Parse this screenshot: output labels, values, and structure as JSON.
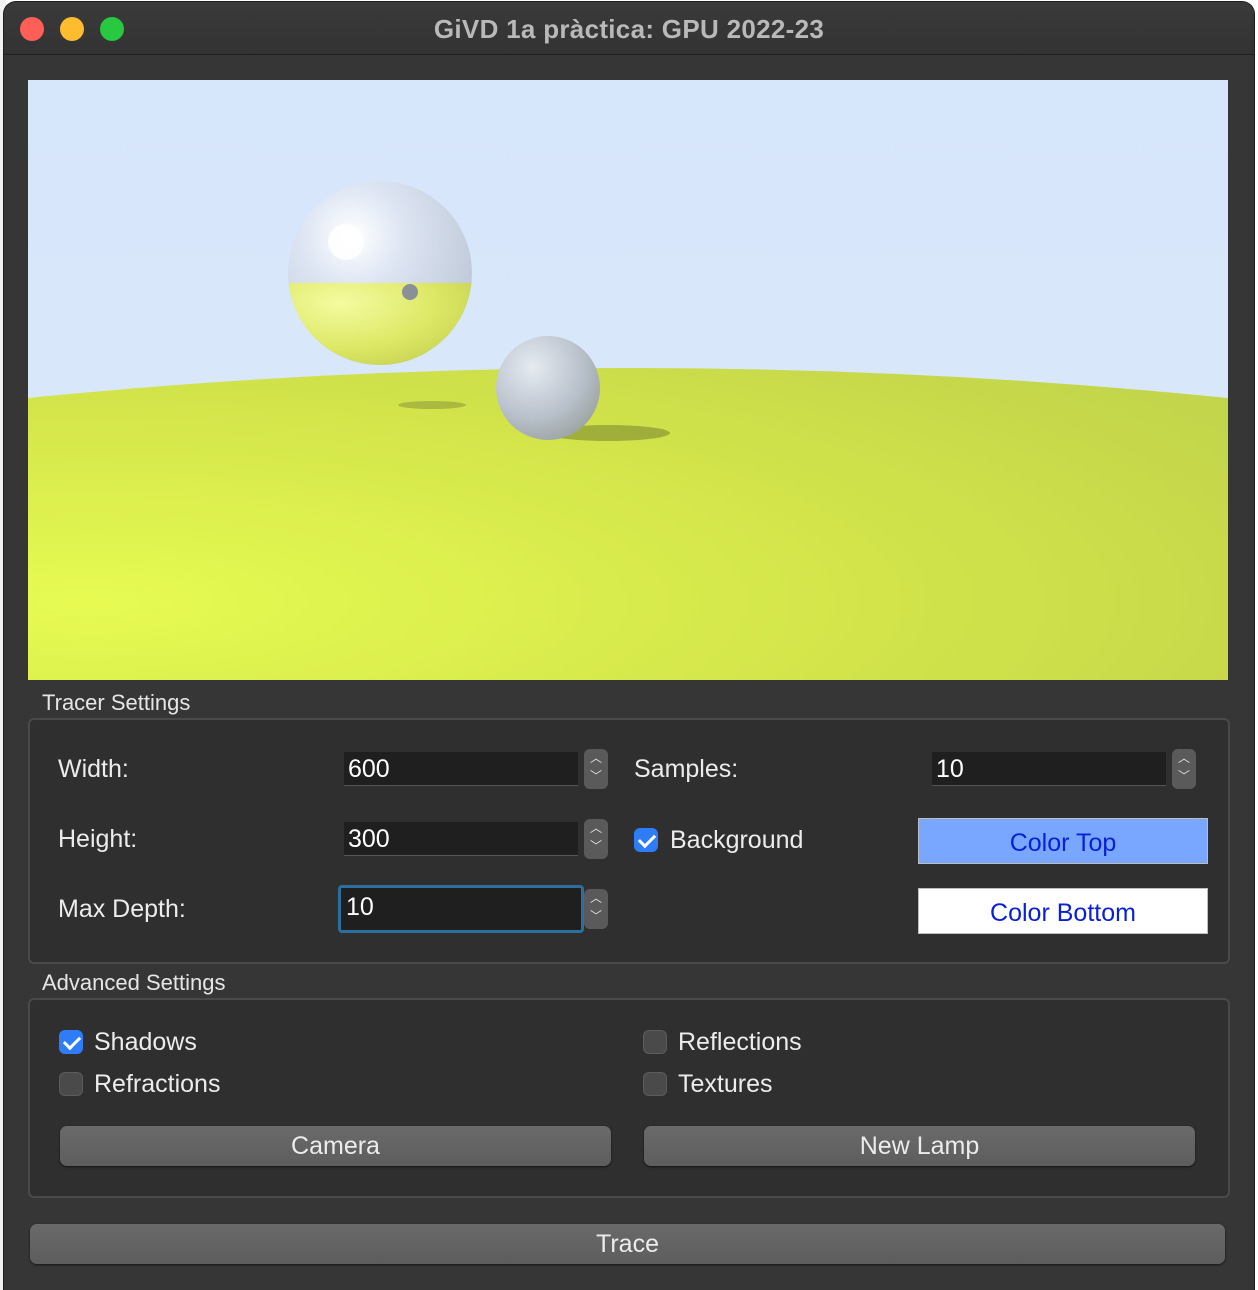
{
  "window": {
    "title": "GiVD 1a pràctica: GPU 2022-23"
  },
  "render": {
    "sky_color": "#d9e7fb",
    "ground_color": "#d4e448"
  },
  "tracer_settings": {
    "title": "Tracer Settings",
    "width_label": "Width:",
    "width_value": "600",
    "height_label": "Height:",
    "height_value": "300",
    "max_depth_label": "Max Depth:",
    "max_depth_value": "10",
    "samples_label": "Samples:",
    "samples_value": "10",
    "background_label": "Background",
    "background_checked": true,
    "color_top_label": "Color Top",
    "color_top_fill": "#79a7ff",
    "color_bottom_label": "Color Bottom",
    "color_bottom_fill": "#ffffff"
  },
  "advanced_settings": {
    "title": "Advanced Settings",
    "shadows_label": "Shadows",
    "shadows_checked": true,
    "reflections_label": "Reflections",
    "reflections_checked": false,
    "refractions_label": "Refractions",
    "refractions_checked": false,
    "textures_label": "Textures",
    "textures_checked": false,
    "camera_label": "Camera",
    "new_lamp_label": "New Lamp"
  },
  "trace_label": "Trace",
  "colors": {
    "accent": "#2e7cf6",
    "window_bg": "#363636",
    "link_text": "#0a20d8"
  }
}
